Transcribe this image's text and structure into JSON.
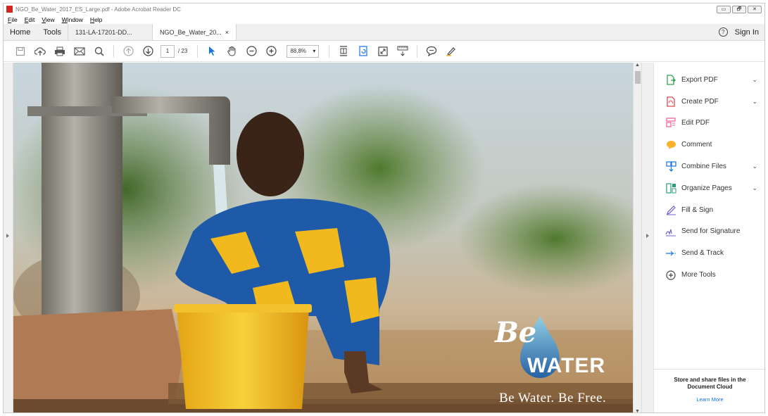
{
  "window": {
    "title": "NGO_Be_Water_2017_ES_Large.pdf - Adobe Acrobat Reader DC",
    "controls": [
      "▭",
      "🗗",
      "✕"
    ]
  },
  "menu": [
    "File",
    "Edit",
    "View",
    "Window",
    "Help"
  ],
  "tabs": {
    "home": "Home",
    "tools": "Tools",
    "doc1": "131-LA-17201-DD...",
    "doc2": "NGO_Be_Water_20...",
    "doc2_close": "×",
    "sign_in": "Sign In"
  },
  "toolbar": {
    "page_current": "1",
    "page_total": "/ 23",
    "zoom": "88,8%"
  },
  "tools": [
    {
      "label": "Export PDF",
      "expand": true,
      "color": "#2da44e"
    },
    {
      "label": "Create PDF",
      "expand": true,
      "color": "#e34850"
    },
    {
      "label": "Edit PDF",
      "expand": false,
      "color": "#f25c95"
    },
    {
      "label": "Comment",
      "expand": false,
      "color": "#f7b32b"
    },
    {
      "label": "Combine Files",
      "expand": true,
      "color": "#1473e6"
    },
    {
      "label": "Organize Pages",
      "expand": true,
      "color": "#2d9d78"
    },
    {
      "label": "Fill & Sign",
      "expand": false,
      "color": "#6e63c7"
    },
    {
      "label": "Send for Signature",
      "expand": false,
      "color": "#6e63c7"
    },
    {
      "label": "Send & Track",
      "expand": false,
      "color": "#1473e6"
    },
    {
      "label": "More Tools",
      "expand": false,
      "color": "#444444"
    }
  ],
  "cloud": {
    "text1": "Store and share files in the",
    "text2": "Document Cloud",
    "link": "Learn More"
  },
  "document": {
    "logo_be": "Be",
    "logo_water": "WATER",
    "tagline": "Be Water. Be Free."
  }
}
